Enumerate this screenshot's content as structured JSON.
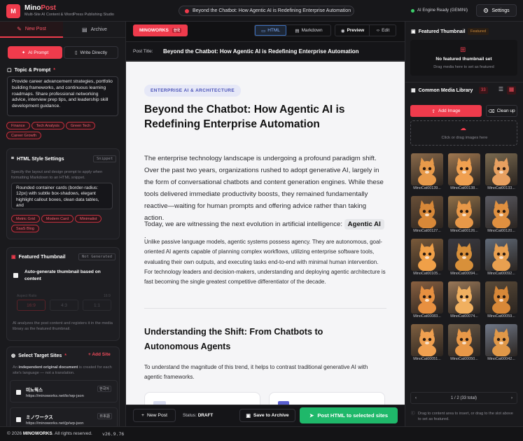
{
  "header": {
    "logo_letter": "M",
    "brand_main": "Mino",
    "brand_accent": "Post",
    "subtitle": "Multi-Site AI Content & WordPress Publishing Studio",
    "current_title": "Beyond the Chatbot: How Agentic AI is Redefining Enterprise Automation",
    "ai_status": "AI Engine Ready (GEMINI)",
    "settings_label": "Settings"
  },
  "left": {
    "tabs": [
      {
        "label": "New Post",
        "active": true
      },
      {
        "label": "Archive",
        "active": false
      }
    ],
    "modes": [
      {
        "label": "AI Prompt",
        "active": true
      },
      {
        "label": "Write Directly",
        "active": false
      }
    ],
    "topic": {
      "title": "Topic & Prompt",
      "required": "*",
      "value": "Provide career advancement strategies, portfolio building frameworks, and continuous learning roadmaps. Share professional networking advice, interview prep tips, and leadership skill development guidance.",
      "chips": [
        "Finance",
        "Tech Analysis",
        "Green Tech",
        "Career Growth"
      ]
    },
    "html_style": {
      "title": "HTML Style Settings",
      "badge": "Snippet",
      "desc": "Specify the layout and design prompt to apply when formatting Markdown to an HTML snippet.",
      "value": "Rounded container cards (border-radius: 12px) with subtle box-shadows, elegant highlight callout boxes, clean data tables, and",
      "chips": [
        "Metric Grid",
        "Modern Card",
        "Minimalist",
        "SaaS Blog"
      ]
    },
    "thumbnail": {
      "title": "Featured Thumbnail",
      "badge": "Not Generated",
      "auto_label": "Auto-generate thumbnail based on content",
      "aspect_label": "Aspect Ratio",
      "aspect_value": "16:9",
      "ratios": [
        "16:9",
        "4:3",
        "1:1"
      ],
      "desc": "AI analyzes the post content and registers it in the media library as the featured thumbnail."
    },
    "sites": {
      "title": "Select Target Sites",
      "required": "*",
      "add_label": "+ Add Site",
      "desc_pre": "An ",
      "desc_bold": "independent original document",
      "desc_post": " is created for each site's language — not a translation.",
      "items": [
        {
          "name": "미노웍스",
          "lang": "한국어",
          "url": "https://minoworks.net/kr/wp-json"
        },
        {
          "name": "ミノワークス",
          "lang": "日本語",
          "url": "https://minoworks.net/jp/wp-json"
        }
      ]
    }
  },
  "center": {
    "site_badge": "MINOWORKS",
    "site_lang": "한국",
    "view_tabs": [
      "HTML",
      "Markdown"
    ],
    "preview_label": "Preview",
    "edit_label": "Edit",
    "post_title_label": "Post Title:",
    "post_title": "Beyond the Chatbot: How Agentic AI is Redefining Enterprise Automation",
    "doc": {
      "category": "ENTERPRISE AI & ARCHITECTURE",
      "h1": "Beyond the Chatbot: How Agentic AI is Redefining Enterprise Automation",
      "p1": "The enterprise technology landscape is undergoing a profound paradigm shift. Over the past two years, organizations rushed to adopt generative AI, largely in the form of conversational chatbots and content generation engines. While these tools delivered immediate productivity boosts, they remained fundamentally reactive—waiting for human prompts and offering advice rather than taking action.",
      "p2_pre": "Today, we are witnessing the next evolution in artificial intelligence:",
      "p2_highlight": "Agentic AI",
      "p2_post": ".",
      "p3": "Unlike passive language models, agentic systems possess agency. They are autonomous, goal-oriented AI agents capable of planning complex workflows, utilizing enterprise software tools, evaluating their own outputs, and executing tasks end-to-end with minimal human intervention. For technology leaders and decision-makers, understanding and deploying agentic architecture is fast becoming the single greatest competitive differentiator of the decade.",
      "h2": "Understanding the Shift: From Chatbots to Autonomous Agents",
      "p4": "To understand the magnitude of this trend, it helps to contrast traditional generative AI with agentic frameworks."
    },
    "bottom": {
      "new_post": "New Post",
      "status_label": "Status:",
      "status_value": "DRAFT",
      "save_label": "Save to Archive",
      "post_label": "Post HTML to selected sites"
    }
  },
  "right": {
    "thumb_title": "Featured Thumbnail",
    "thumb_badge": "Featured",
    "no_thumb": "No featured thumbnail set",
    "no_thumb_hint": "Drag media here to set as featured",
    "lib_title": "Common Media Library",
    "lib_count": "33",
    "add_image": "Add Image",
    "cleanup": "Clean up",
    "drop_hint": "Click or drag images here",
    "images": [
      "MinoCat00139...",
      "MinoCat00138...",
      "MinoCat00133...",
      "MinoCat00127...",
      "MinoCat00126...",
      "MinoCat00120...",
      "MinoCat00105...",
      "MinoCat00094...",
      "MinoCat00092...",
      "MinoCat00083...",
      "MinoCat00074...",
      "MinoCat00059...",
      "MinoCat00051...",
      "MinoCat00050...",
      "MinoCat00042..."
    ],
    "pagination": "1 / 2 (33 total)",
    "tip": "Drag to content area to insert, or drag to the slot above to set as featured."
  },
  "footer": {
    "copyright_pre": "© 2026 ",
    "copyright_brand": "MINOWORKS",
    "copyright_post": ". All rights reserved.",
    "version": "v26.9.76"
  },
  "colors": {
    "accent": "#ef3b4c",
    "success": "#1fb86a",
    "bg": "#141416"
  }
}
